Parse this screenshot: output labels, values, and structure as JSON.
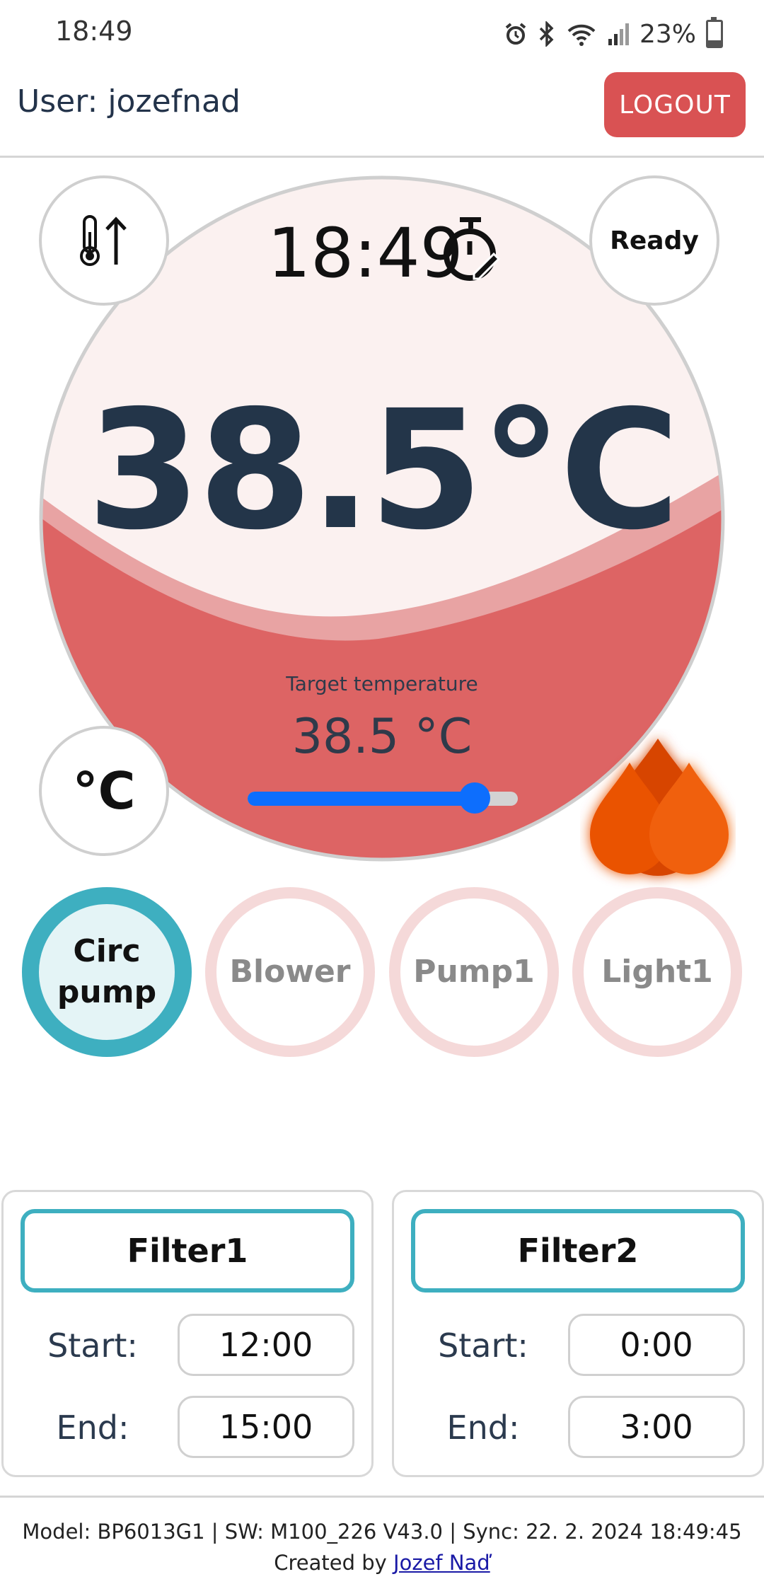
{
  "status_bar": {
    "time": "18:49",
    "battery": "23%"
  },
  "header": {
    "user_label": "User: jozefnad",
    "logout_label": "LOGOUT"
  },
  "gauge": {
    "timer": "18:49",
    "ready_label": "Ready",
    "current_temp": "38.5°C",
    "unit_label": "°C",
    "target_label": "Target temperature",
    "target_value": "38.5 °C",
    "slider_fraction": 0.84,
    "water_color": "#dd6464",
    "accent_color": "#0d6efd"
  },
  "toggles": [
    {
      "label": "Circ\npump",
      "on": true
    },
    {
      "label": "Blower",
      "on": false
    },
    {
      "label": "Pump1",
      "on": false
    },
    {
      "label": "Light1",
      "on": false
    }
  ],
  "filters": [
    {
      "title": "Filter1",
      "start_label": "Start:",
      "start": "12:00",
      "end_label": "End:",
      "end": "15:00"
    },
    {
      "title": "Filter2",
      "start_label": "Start:",
      "start": "0:00",
      "end_label": "End:",
      "end": "3:00"
    }
  ],
  "footer": {
    "info": "Model: BP6013G1 | SW: M100_226 V43.0 | Sync: 22. 2. 2024 18:49:45",
    "credit_prefix": "Created by ",
    "credit_name": "Jozef Naď"
  },
  "icons": [
    "alarm-icon",
    "bluetooth-icon",
    "wifi-icon",
    "signal-icon",
    "battery-icon",
    "thermometer-up-icon",
    "stopwatch-icon",
    "flame-icon"
  ],
  "colors": {
    "logout": "#d95253",
    "toggle_on": "#3eafc0",
    "toggle_off": "#f5d9d9",
    "temp_text": "#233549"
  }
}
